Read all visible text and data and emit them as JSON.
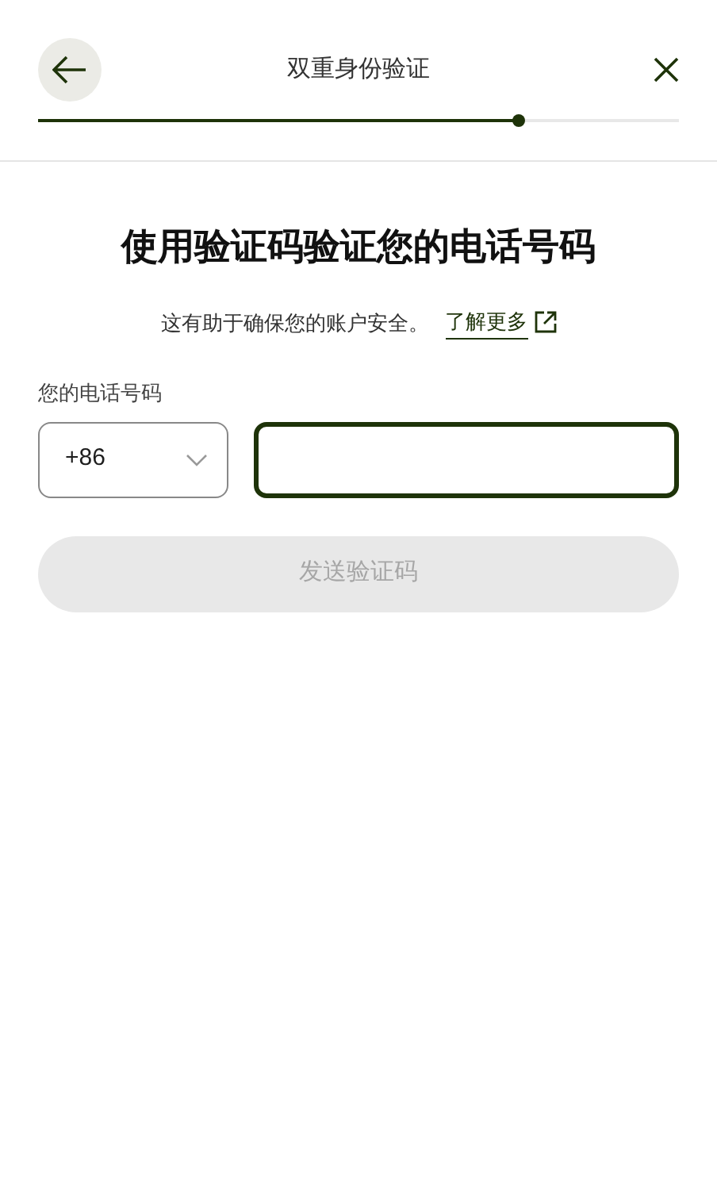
{
  "header": {
    "title": "双重身份验证",
    "progress": {
      "level": 0.75
    }
  },
  "heading": "使用验证码验证您的电话号码",
  "helper": {
    "text": "这有助于确保您的账户安全。",
    "link": "了解更多"
  },
  "phone": {
    "label": "您的电话号码",
    "country_code": "+86",
    "number_focused": true
  },
  "send_button": {
    "label": "发送验证码",
    "disabled": true
  }
}
